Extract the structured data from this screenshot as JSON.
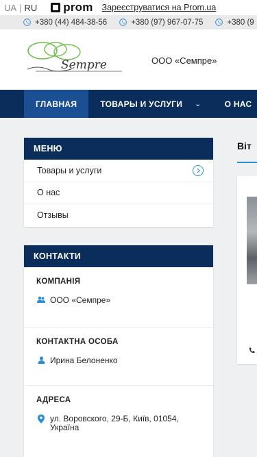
{
  "topbar": {
    "lang_ua": "UA",
    "lang_sep": "|",
    "lang_ru": "RU",
    "prom_logo": "prom",
    "register_link": "Зареєструватися на Prom.ua"
  },
  "phones": [
    "+380 (44) 484-38-56",
    "+380 (97) 967-07-75",
    "+380 (9"
  ],
  "header": {
    "company_name": "ООО «Семпре»",
    "logo_text": "Sempre"
  },
  "nav": {
    "home": "ГЛАВНАЯ",
    "products": "ТОВАРЫ И УСЛУГИ",
    "products_chevron": "⌄",
    "about": "О НАС"
  },
  "menu": {
    "title": "МЕНЮ",
    "items": [
      "Товары и услуги",
      "О нас",
      "Отзывы"
    ]
  },
  "contacts": {
    "title": "КОНТАКТИ",
    "company_label": "КОМПАНІЯ",
    "company_value": "ООО «Семпре»",
    "person_label": "КОНТАКТНА ОСОБА",
    "person_value": "Ирина Белоненко",
    "address_label": "АДРЕСА",
    "address_line1": "ул. Воровского, 29-Б, Київ, 01054,",
    "address_line2": "Україна"
  },
  "right": {
    "title": "Віт"
  },
  "colors": {
    "nav_bg": "#0b2d5b",
    "nav_active": "#1a4f93",
    "accent": "#2a8ed6"
  }
}
